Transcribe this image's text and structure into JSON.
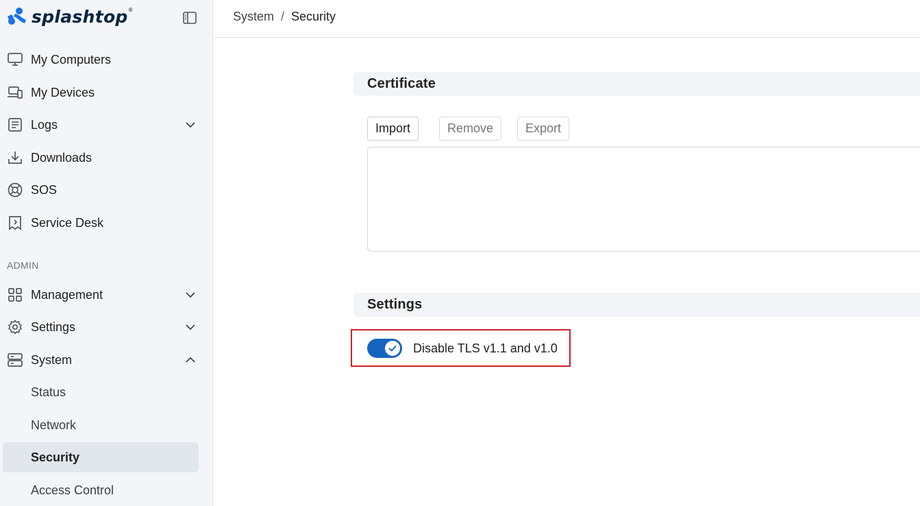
{
  "brand": {
    "name": "splashtop",
    "trademark": "®"
  },
  "breadcrumb": {
    "parent": "System",
    "separator": "/",
    "current": "Security"
  },
  "sidebar": {
    "items": [
      {
        "label": "My Computers",
        "icon": "monitor-icon"
      },
      {
        "label": "My Devices",
        "icon": "devices-icon"
      },
      {
        "label": "Logs",
        "icon": "logs-icon",
        "expandable": true
      },
      {
        "label": "Downloads",
        "icon": "download-icon"
      },
      {
        "label": "SOS",
        "icon": "sos-icon"
      },
      {
        "label": "Service Desk",
        "icon": "service-desk-icon"
      }
    ],
    "admin_heading": "ADMIN",
    "admin_items": [
      {
        "label": "Management",
        "icon": "grid-icon",
        "expandable": true
      },
      {
        "label": "Settings",
        "icon": "gear-icon",
        "expandable": true
      },
      {
        "label": "System",
        "icon": "server-icon",
        "expanded": true
      }
    ],
    "system_subitems": [
      {
        "label": "Status"
      },
      {
        "label": "Network"
      },
      {
        "label": "Security",
        "active": true
      },
      {
        "label": "Access Control"
      }
    ]
  },
  "certificate": {
    "title": "Certificate",
    "buttons": {
      "import": "Import",
      "remove": "Remove",
      "export": "Export"
    }
  },
  "settings": {
    "title": "Settings",
    "tls_toggle": {
      "label": "Disable TLS v1.1 and v1.0",
      "enabled": true
    }
  },
  "colors": {
    "accent": "#1565c0",
    "highlight_border": "#d0202a",
    "sidebar_bg": "#f3f5f8"
  }
}
